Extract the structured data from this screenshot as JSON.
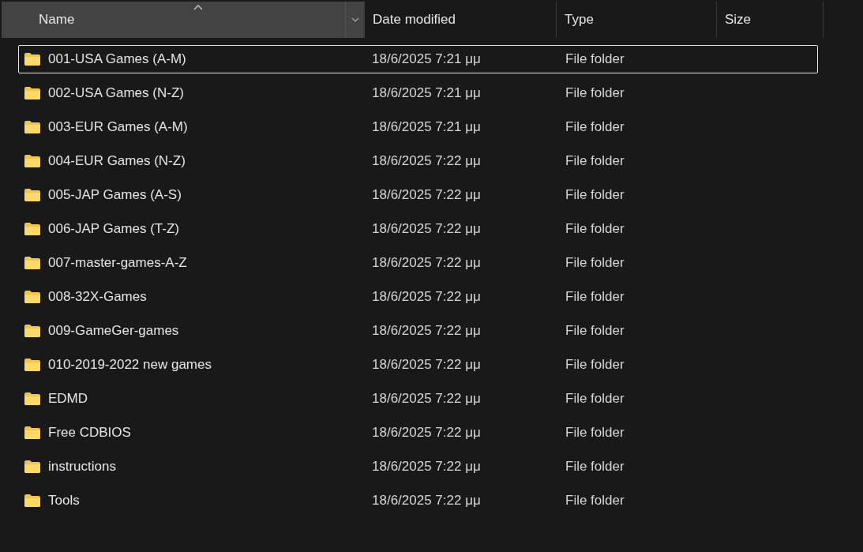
{
  "columns": [
    {
      "label": "Name",
      "sorted": true
    },
    {
      "label": "Date modified",
      "sorted": false
    },
    {
      "label": "Type",
      "sorted": false
    },
    {
      "label": "Size",
      "sorted": false
    }
  ],
  "rows": [
    {
      "name": "001-USA Games (A-M)",
      "date": "18/6/2025 7:21 μμ",
      "type": "File folder",
      "focused": true
    },
    {
      "name": "002-USA Games (N-Z)",
      "date": "18/6/2025 7:21 μμ",
      "type": "File folder",
      "focused": false
    },
    {
      "name": "003-EUR Games (A-M)",
      "date": "18/6/2025 7:21 μμ",
      "type": "File folder",
      "focused": false
    },
    {
      "name": "004-EUR Games (N-Z)",
      "date": "18/6/2025 7:22 μμ",
      "type": "File folder",
      "focused": false
    },
    {
      "name": "005-JAP Games (A-S)",
      "date": "18/6/2025 7:22 μμ",
      "type": "File folder",
      "focused": false
    },
    {
      "name": "006-JAP Games (T-Z)",
      "date": "18/6/2025 7:22 μμ",
      "type": "File folder",
      "focused": false
    },
    {
      "name": "007-master-games-A-Z",
      "date": "18/6/2025 7:22 μμ",
      "type": "File folder",
      "focused": false
    },
    {
      "name": "008-32X-Games",
      "date": "18/6/2025 7:22 μμ",
      "type": "File folder",
      "focused": false
    },
    {
      "name": "009-GameGer-games",
      "date": "18/6/2025 7:22 μμ",
      "type": "File folder",
      "focused": false
    },
    {
      "name": "010-2019-2022 new games",
      "date": "18/6/2025 7:22 μμ",
      "type": "File folder",
      "focused": false
    },
    {
      "name": "EDMD",
      "date": "18/6/2025 7:22 μμ",
      "type": "File folder",
      "focused": false
    },
    {
      "name": "Free CDBIOS",
      "date": "18/6/2025 7:22 μμ",
      "type": "File folder",
      "focused": false
    },
    {
      "name": "instructions",
      "date": "18/6/2025 7:22 μμ",
      "type": "File folder",
      "focused": false
    },
    {
      "name": "Tools",
      "date": "18/6/2025 7:22 μμ",
      "type": "File folder",
      "focused": false
    }
  ]
}
